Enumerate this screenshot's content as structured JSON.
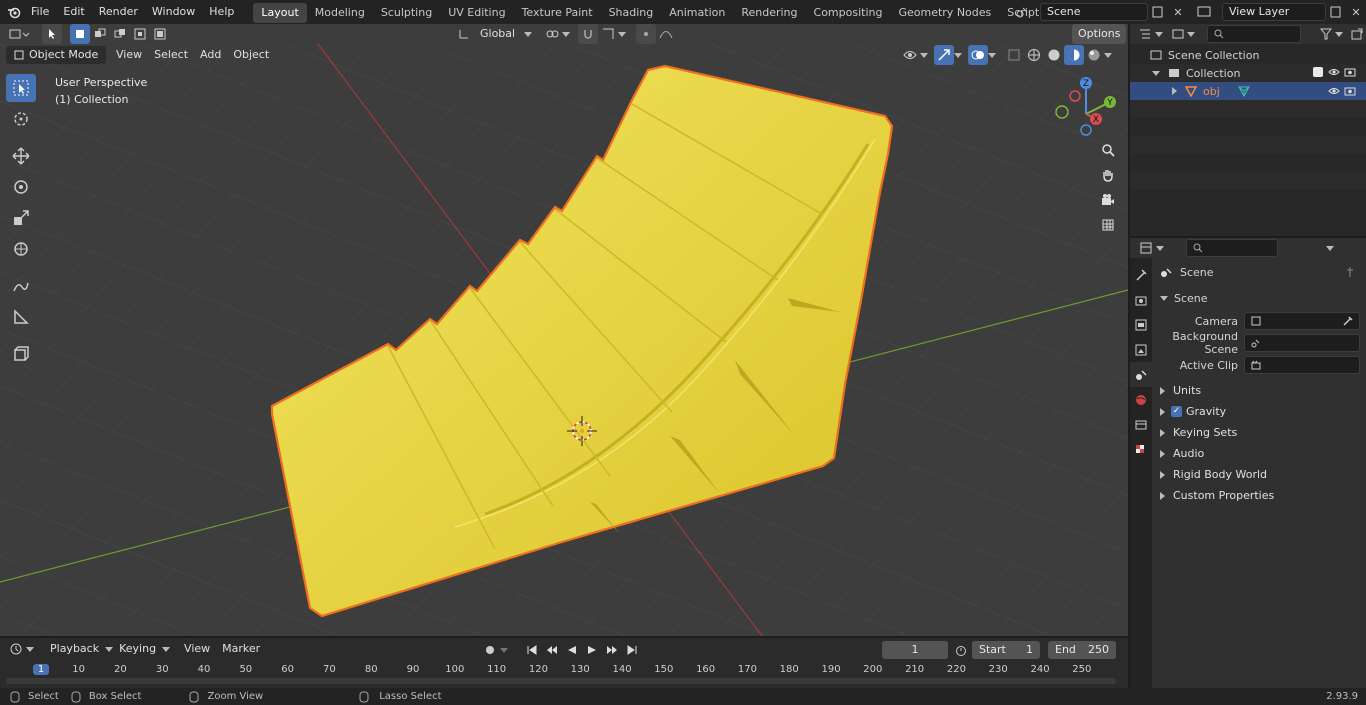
{
  "menus": [
    "File",
    "Edit",
    "Render",
    "Window",
    "Help"
  ],
  "workspaces": [
    "Layout",
    "Modeling",
    "Sculpting",
    "UV Editing",
    "Texture Paint",
    "Shading",
    "Animation",
    "Rendering",
    "Compositing",
    "Geometry Nodes",
    "Scripting"
  ],
  "active_workspace": "Layout",
  "scene_name": "Scene",
  "view_layer": "View Layer",
  "viewport_header": {
    "mode": "Object Mode",
    "view": "View",
    "select": "Select",
    "add": "Add",
    "object": "Object",
    "orientation": "Global",
    "options": "Options"
  },
  "viewport_overlay": {
    "perspective": "User Perspective",
    "collection": "(1) Collection"
  },
  "gizmo": {
    "z": "Z",
    "y": "Y",
    "x": "X"
  },
  "outliner": {
    "scene_collection": "Scene Collection",
    "collection": "Collection",
    "object": "obj"
  },
  "properties": {
    "context": "Scene",
    "section": "Scene",
    "camera_label": "Camera",
    "background_scene_label": "Background Scene",
    "active_clip_label": "Active Clip",
    "panels": [
      "Units",
      "Gravity",
      "Keying Sets",
      "Audio",
      "Rigid Body World",
      "Custom Properties"
    ],
    "gravity_checked": true
  },
  "timeline": {
    "playback": "Playback",
    "keying": "Keying",
    "view": "View",
    "marker": "Marker",
    "current_frame": "1",
    "start_label": "Start",
    "start": "1",
    "end_label": "End",
    "end": "250",
    "ruler": [
      "1",
      "10",
      "20",
      "30",
      "40",
      "50",
      "60",
      "70",
      "80",
      "90",
      "100",
      "110",
      "120",
      "130",
      "140",
      "150",
      "160",
      "170",
      "180",
      "190",
      "200",
      "210",
      "220",
      "230",
      "240",
      "250"
    ]
  },
  "status": {
    "select": "Select",
    "box_select": "Box Select",
    "zoom_view": "Zoom View",
    "lasso_select": "Lasso Select",
    "version": "2.93.9"
  },
  "colors": {
    "accent": "#4772b3",
    "object_yellow": "#e8d53a",
    "selection_orange": "#f07020",
    "x_axis": "#d94d55",
    "y_axis": "#7ab83a",
    "z_axis": "#4d8fe0"
  }
}
